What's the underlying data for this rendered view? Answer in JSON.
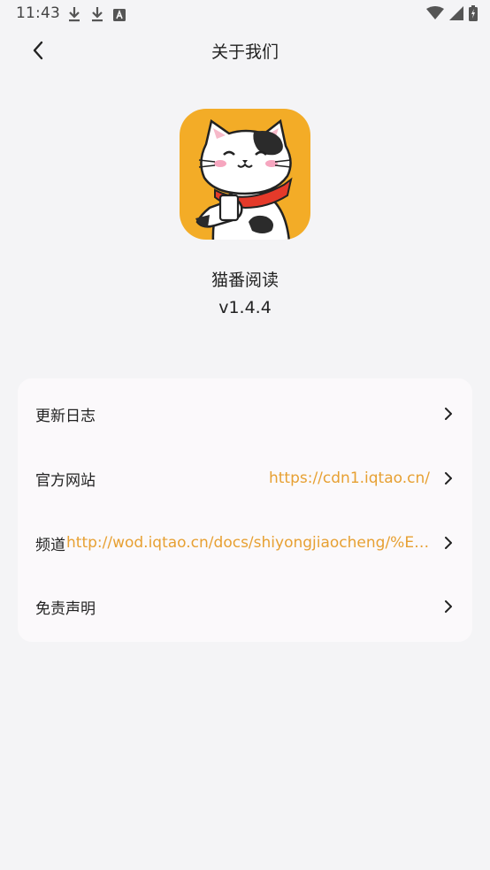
{
  "status_bar": {
    "time": "11:43",
    "icons_left": [
      "download-icon",
      "download-icon",
      "font-a-icon"
    ],
    "icons_right": [
      "wifi-icon",
      "signal-icon",
      "battery-charging-icon"
    ]
  },
  "header": {
    "title": "关于我们",
    "back_icon": "chevron-left-icon"
  },
  "app": {
    "name": "猫番阅读",
    "version": "v1.4.4",
    "logo_bg": "#f3ac27"
  },
  "menu": {
    "items": [
      {
        "label": "更新日志",
        "value": ""
      },
      {
        "label": "官方网站",
        "value": "https://cdn1.iqtao.cn/"
      },
      {
        "label": "频道",
        "value": "http://wod.iqtao.cn/docs/shiyongjiaocheng/%E5%…"
      },
      {
        "label": "免责声明",
        "value": ""
      }
    ]
  },
  "colors": {
    "background": "#f4f4f6",
    "card": "#fbf9fb",
    "link": "#e7a032",
    "text": "#222222"
  }
}
